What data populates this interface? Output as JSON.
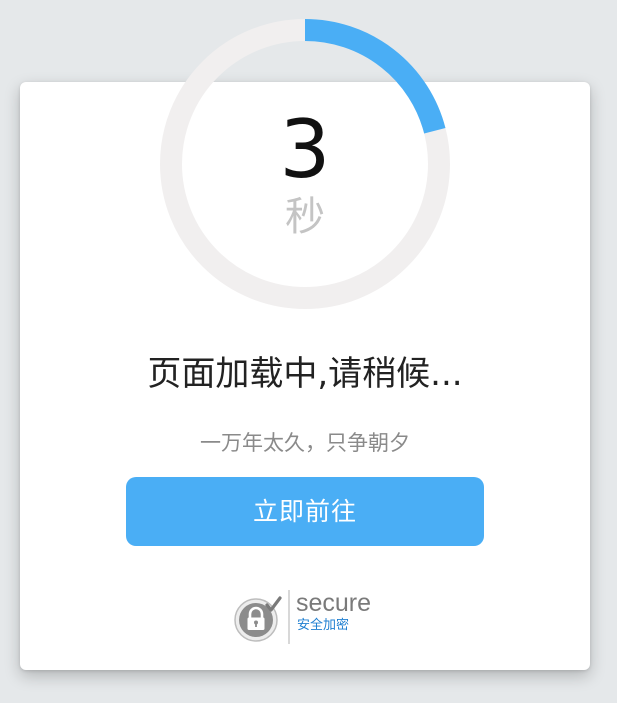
{
  "countdown": {
    "seconds": "3",
    "unit": "秒",
    "progress_fraction": 0.21
  },
  "status": {
    "title": "页面加载中,请稍候...",
    "slogan": "一万年太久，只争朝夕"
  },
  "actions": {
    "go_now_label": "立即前往"
  },
  "security_badge": {
    "word": "secure",
    "subtitle": "安全加密",
    "icon": "padlock-check-icon"
  },
  "colors": {
    "accent": "#4aaef5",
    "ring_track": "#f1efef",
    "badge_link": "#1f7fd1",
    "background": "#e5e8ea"
  }
}
